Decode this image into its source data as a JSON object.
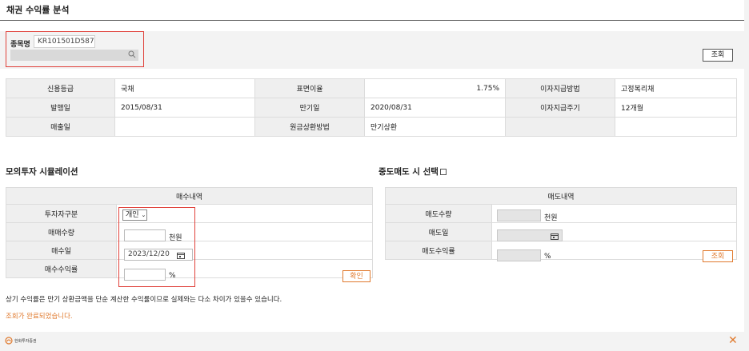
{
  "page": {
    "title": "채권 수익률 분석"
  },
  "search": {
    "label": "종목명",
    "code": "KR101501D587",
    "query_button": "조회"
  },
  "bond_info": {
    "rows": [
      [
        {
          "label": "신용등급",
          "value": "국채",
          "align": "left"
        },
        {
          "label": "표면이율",
          "value": "1.75%",
          "align": "right"
        },
        {
          "label": "이자지급방법",
          "value": "고정복리채",
          "align": "left"
        }
      ],
      [
        {
          "label": "발행일",
          "value": "2015/08/31",
          "align": "left"
        },
        {
          "label": "만기일",
          "value": "2020/08/31",
          "align": "left"
        },
        {
          "label": "이자지급주기",
          "value": "12개월",
          "align": "left"
        }
      ],
      [
        {
          "label": "매출일",
          "value": "",
          "align": "left"
        },
        {
          "label": "원금상환방법",
          "value": "만기상환",
          "align": "left"
        },
        {
          "label": "",
          "value": "",
          "align": "left"
        }
      ]
    ]
  },
  "simulation": {
    "title": "모의투자 시뮬레이션",
    "header": "매수내역",
    "investor_type_label": "투자자구분",
    "investor_type_value": "개인",
    "qty_label": "매매수량",
    "qty_unit": "천원",
    "date_label": "매수일",
    "date_value": "2023/12/20",
    "yield_label": "매수수익률",
    "yield_unit": "%",
    "confirm_button": "확인"
  },
  "sell": {
    "title": "중도매도 시 선택",
    "header": "매도내역",
    "qty_label": "매도수량",
    "qty_unit": "천원",
    "date_label": "매도일",
    "yield_label": "매도수익률",
    "yield_unit": "%",
    "query_button": "조회"
  },
  "note": "상기 수익률은 만기 상환금액을 단순 계산한 수익률이므로 실제와는 다소 차이가 있을수 있습니다.",
  "status": "조회가 완료되었습니다.",
  "footer": {
    "brand": "한화투자증권"
  },
  "colors": {
    "accent": "#e07a2e",
    "highlight": "#e0413a"
  }
}
